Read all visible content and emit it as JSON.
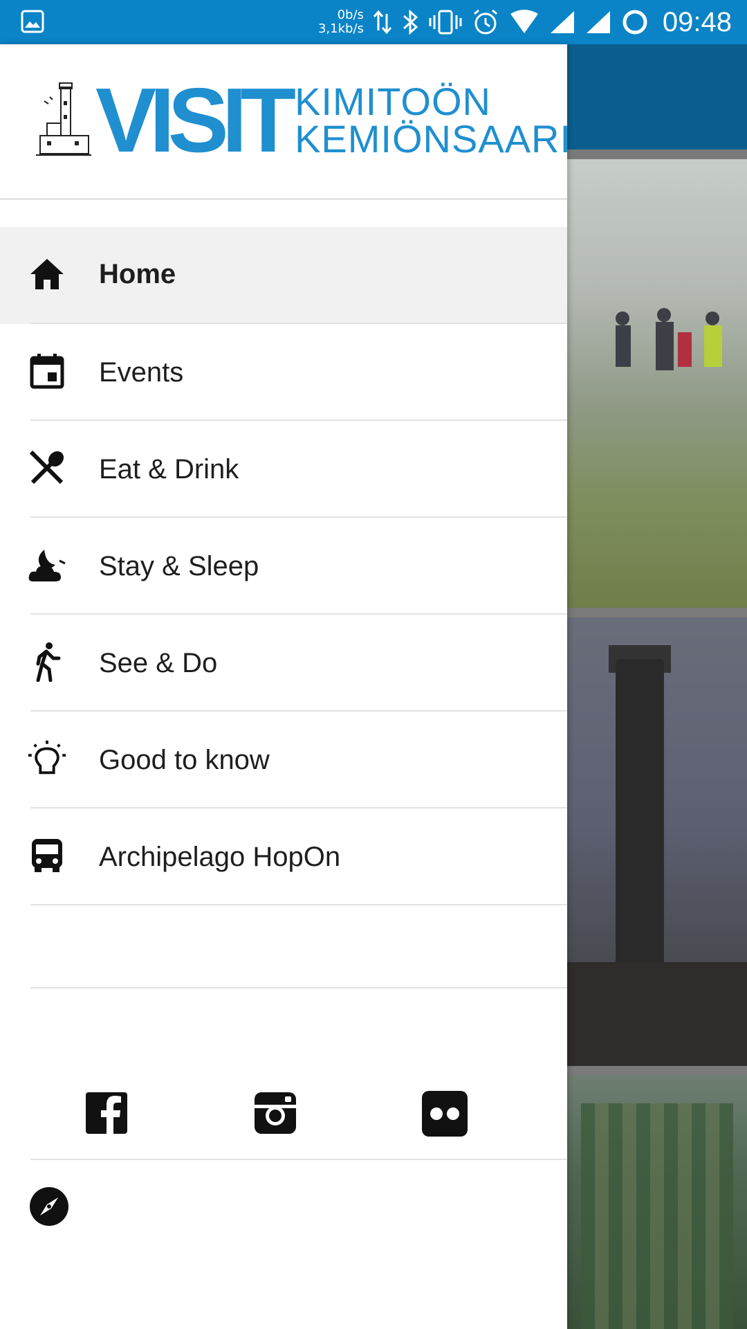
{
  "status_bar": {
    "net_down": "0b/s",
    "net_up": "3,1kb/s",
    "time": "09:48"
  },
  "drawer": {
    "logo": {
      "visit": "VISIT",
      "line1": "KIMITOÖN",
      "line2": "KEMIÖNSAARI"
    },
    "menu": [
      {
        "label": "Home",
        "icon": "home-icon",
        "active": true
      },
      {
        "label": "Events",
        "icon": "calendar-icon",
        "active": false
      },
      {
        "label": "Eat & Drink",
        "icon": "fork-spoon-icon",
        "active": false
      },
      {
        "label": "Stay & Sleep",
        "icon": "moon-cloud-icon",
        "active": false
      },
      {
        "label": "See & Do",
        "icon": "walking-person-icon",
        "active": false
      },
      {
        "label": "Good to know",
        "icon": "lightbulb-icon",
        "active": false
      },
      {
        "label": "Archipelago HopOn",
        "icon": "bus-icon",
        "active": false
      }
    ],
    "social": [
      "facebook-icon",
      "instagram-icon",
      "flickr-icon"
    ],
    "footer_icon": "compass-icon"
  },
  "colors": {
    "status_bar": "#0a84c6",
    "brand_blue": "#1f8fd0",
    "app_toolbar": "#0a5f8e",
    "active_item_bg": "#f1f1f1"
  }
}
